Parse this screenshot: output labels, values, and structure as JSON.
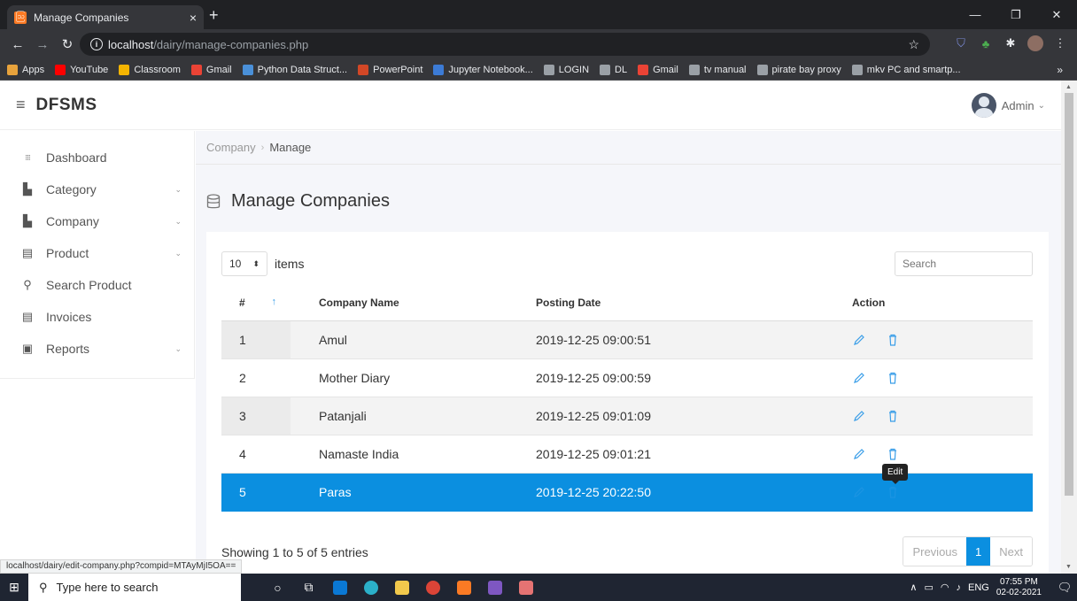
{
  "browser": {
    "tab_title": "Manage Companies",
    "tab_close": "×",
    "new_tab": "+",
    "url_host": "localhost",
    "url_path": "/dairy/manage-companies.php",
    "bookmarks": [
      {
        "label": "Apps",
        "color": "#e8a33c"
      },
      {
        "label": "YouTube",
        "color": "#ff0000"
      },
      {
        "label": "Classroom",
        "color": "#f4b400"
      },
      {
        "label": "Gmail",
        "color": "#ea4335"
      },
      {
        "label": "Python Data Struct...",
        "color": "#4a90d9"
      },
      {
        "label": "PowerPoint",
        "color": "#d24726"
      },
      {
        "label": "Jupyter Notebook...",
        "color": "#3c7bd6"
      },
      {
        "label": "LOGIN",
        "color": "#9aa0a6"
      },
      {
        "label": "DL",
        "color": "#9aa0a6"
      },
      {
        "label": "Gmail",
        "color": "#ea4335"
      },
      {
        "label": "tv manual",
        "color": "#9aa0a6"
      },
      {
        "label": "pirate bay proxy",
        "color": "#9aa0a6"
      },
      {
        "label": "mkv PC and smartp...",
        "color": "#9aa0a6"
      }
    ],
    "bookmarks_more": "»",
    "status_url": "localhost/dairy/edit-company.php?compid=MTAyMjI5OA=="
  },
  "header": {
    "brand": "DFSMS",
    "user": "Admin"
  },
  "sidebar": {
    "items": [
      {
        "label": "Dashboard",
        "icon": "grid-icon",
        "has_caret": false
      },
      {
        "label": "Category",
        "icon": "file-icon",
        "has_caret": true
      },
      {
        "label": "Company",
        "icon": "file-icon",
        "has_caret": true
      },
      {
        "label": "Product",
        "icon": "list-icon",
        "has_caret": true
      },
      {
        "label": "Search Product",
        "icon": "search-icon",
        "has_caret": false
      },
      {
        "label": "Invoices",
        "icon": "list-icon",
        "has_caret": false
      },
      {
        "label": "Reports",
        "icon": "box-icon",
        "has_caret": true
      }
    ]
  },
  "breadcrumb": {
    "parent": "Company",
    "current": "Manage"
  },
  "page": {
    "title": "Manage Companies"
  },
  "table_controls": {
    "length_value": "10",
    "length_label": "items",
    "search_placeholder": "Search"
  },
  "table": {
    "headers": [
      "#",
      "Company Name",
      "Posting Date",
      "Action"
    ],
    "rows": [
      {
        "num": "1",
        "name": "Amul",
        "date": "2019-12-25 09:00:51"
      },
      {
        "num": "2",
        "name": "Mother Diary",
        "date": "2019-12-25 09:00:59"
      },
      {
        "num": "3",
        "name": "Patanjali",
        "date": "2019-12-25 09:01:09"
      },
      {
        "num": "4",
        "name": "Namaste India",
        "date": "2019-12-25 09:01:21"
      },
      {
        "num": "5",
        "name": "Paras",
        "date": "2019-12-25 20:22:50"
      }
    ],
    "selected_row": 5,
    "tooltip": "Edit"
  },
  "footer": {
    "info": "Showing 1 to 5 of 5 entries",
    "prev": "Previous",
    "page": "1",
    "next": "Next"
  },
  "taskbar": {
    "search_placeholder": "Type here to search",
    "lang": "ENG",
    "time": "07:55 PM",
    "date": "02-02-2021"
  },
  "colors": {
    "accent": "#0b8fe0",
    "sidebar_text": "#555555"
  }
}
